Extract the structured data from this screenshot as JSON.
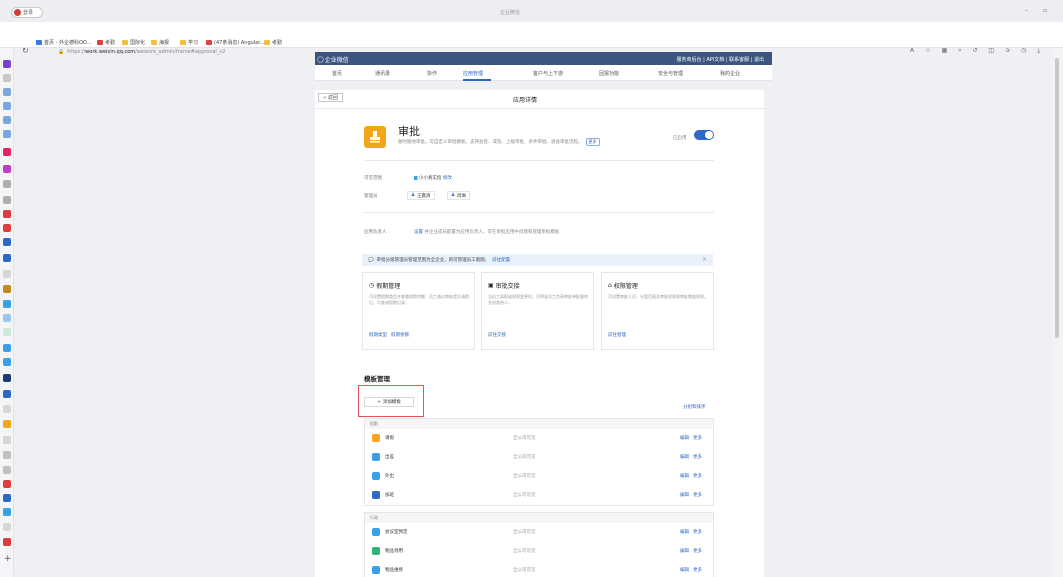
{
  "browser": {
    "profile_label": "登录",
    "tab_title": "企业微信",
    "url_prefix": "https://",
    "url_domain": "work.weixin.qq.com",
    "url_path": "/wework_admin/frame#approval_v2",
    "bookmarks": [
      "首页 - 外企德科OO...",
      "考勤",
      "国际化",
      "海报",
      "学习",
      "(47条消息) Angular...",
      "考勤"
    ]
  },
  "header": {
    "logo_text": "企业微信",
    "top_links": "服务商后台 | API文档 | 联系客服 | 退出",
    "menu": [
      {
        "label": "首页"
      },
      {
        "label": "通讯录"
      },
      {
        "label": "协作"
      },
      {
        "label": "应用管理",
        "active": true
      },
      {
        "label": "客户与上下游"
      },
      {
        "label": "固报功能"
      },
      {
        "label": "安全与管理"
      },
      {
        "label": "我的企业"
      }
    ]
  },
  "page": {
    "back_label": "« 返回",
    "title": "应用详情"
  },
  "app": {
    "name": "审批",
    "description": "随时随地审批。可自定义审批模板，支持会签、或签、上级审批、条件审批、退会审批流程。",
    "more_badge": "更多",
    "enabled_label": "已启用",
    "enabled": true
  },
  "visible_range": {
    "label": "可见范围",
    "value": "小小真实指",
    "edit_link": "修改"
  },
  "admins": {
    "label": "管理员",
    "people": [
      "王赢清",
      "周琳"
    ]
  },
  "owner": {
    "label": "应用负责人",
    "link": "设置",
    "text": "并企业成员配置为应用负责人，可在审批应用中创建和管理审批模板"
  },
  "notice": {
    "text": "审批分级管理员管理范围为全企业，则可管理员工假期。",
    "link": "前往配置",
    "close": "×"
  },
  "features": [
    {
      "title": "假期管理",
      "icon": "clock-icon",
      "desc": "可设置假期类型并查看假期余额，员工通过审批提交请假后，可查询假期记录。",
      "links": [
        "假期类型",
        "假期余额"
      ]
    },
    {
      "title": "审批交接",
      "icon": "handover-icon",
      "desc": "当员工离职或权限变更时，可将该员工负责审批单批量转交给其他人。",
      "links": [
        "前往交接"
      ]
    },
    {
      "title": "权限管理",
      "icon": "lock-icon",
      "desc": "可设置审批人员、分管范围及审批权限和审批数据权限。",
      "links": [
        "前往管理"
      ]
    }
  ],
  "templates": {
    "section_title": "模板管理",
    "add_label": "添加模板",
    "sort_link": "分组和排序",
    "action_edit": "编辑",
    "action_more": "更多",
    "groups": [
      {
        "name": "假勤",
        "rows": [
          {
            "name": "请假",
            "scope": "全公司可见",
            "color": "#f5a623"
          },
          {
            "name": "出差",
            "scope": "全公司可见",
            "color": "#3aa0e8"
          },
          {
            "name": "外出",
            "scope": "全公司可见",
            "color": "#3aa0e8"
          },
          {
            "name": "加班",
            "scope": "全公司可见",
            "color": "#2c68c8"
          }
        ]
      },
      {
        "name": "行政",
        "rows": [
          {
            "name": "会议室预定",
            "scope": "全公司可见",
            "color": "#3aa0e8"
          },
          {
            "name": "物品领用",
            "scope": "全公司可见",
            "color": "#34b27b"
          },
          {
            "name": "物品维修",
            "scope": "全公司可见",
            "color": "#3aa0e8"
          }
        ]
      }
    ]
  }
}
